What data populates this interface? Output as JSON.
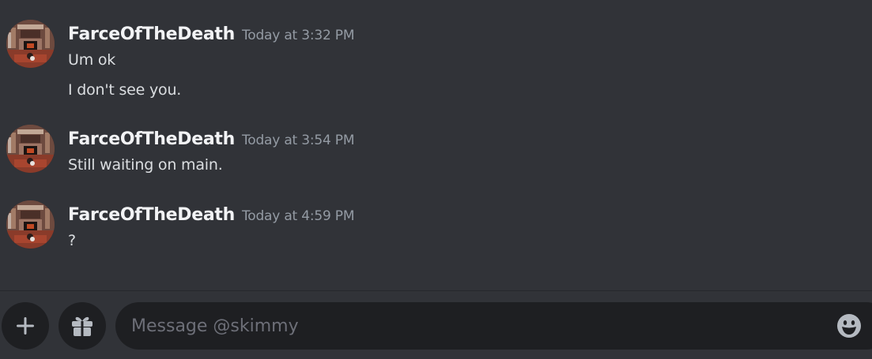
{
  "messages": [
    {
      "author": "FarceOfTheDeath",
      "timestamp": "Today at 3:32 PM",
      "lines": [
        "Um ok",
        "I don't see you."
      ]
    },
    {
      "author": "FarceOfTheDeath",
      "timestamp": "Today at 3:54 PM",
      "lines": [
        "Still waiting on main."
      ]
    },
    {
      "author": "FarceOfTheDeath",
      "timestamp": "Today at 4:59 PM",
      "lines": [
        "?"
      ]
    }
  ],
  "composer": {
    "placeholder": "Message @skimmy",
    "value": "",
    "add_icon": "plus-icon",
    "gift_icon": "gift-icon",
    "emoji_icon": "emoji-icon"
  },
  "colors": {
    "background": "#313338",
    "input_background": "#1e1f22",
    "username": "#f2f3f5",
    "timestamp": "#949ba4",
    "message_text": "#dbdee1",
    "placeholder": "#6d6f78",
    "icon": "#b5bac1"
  }
}
